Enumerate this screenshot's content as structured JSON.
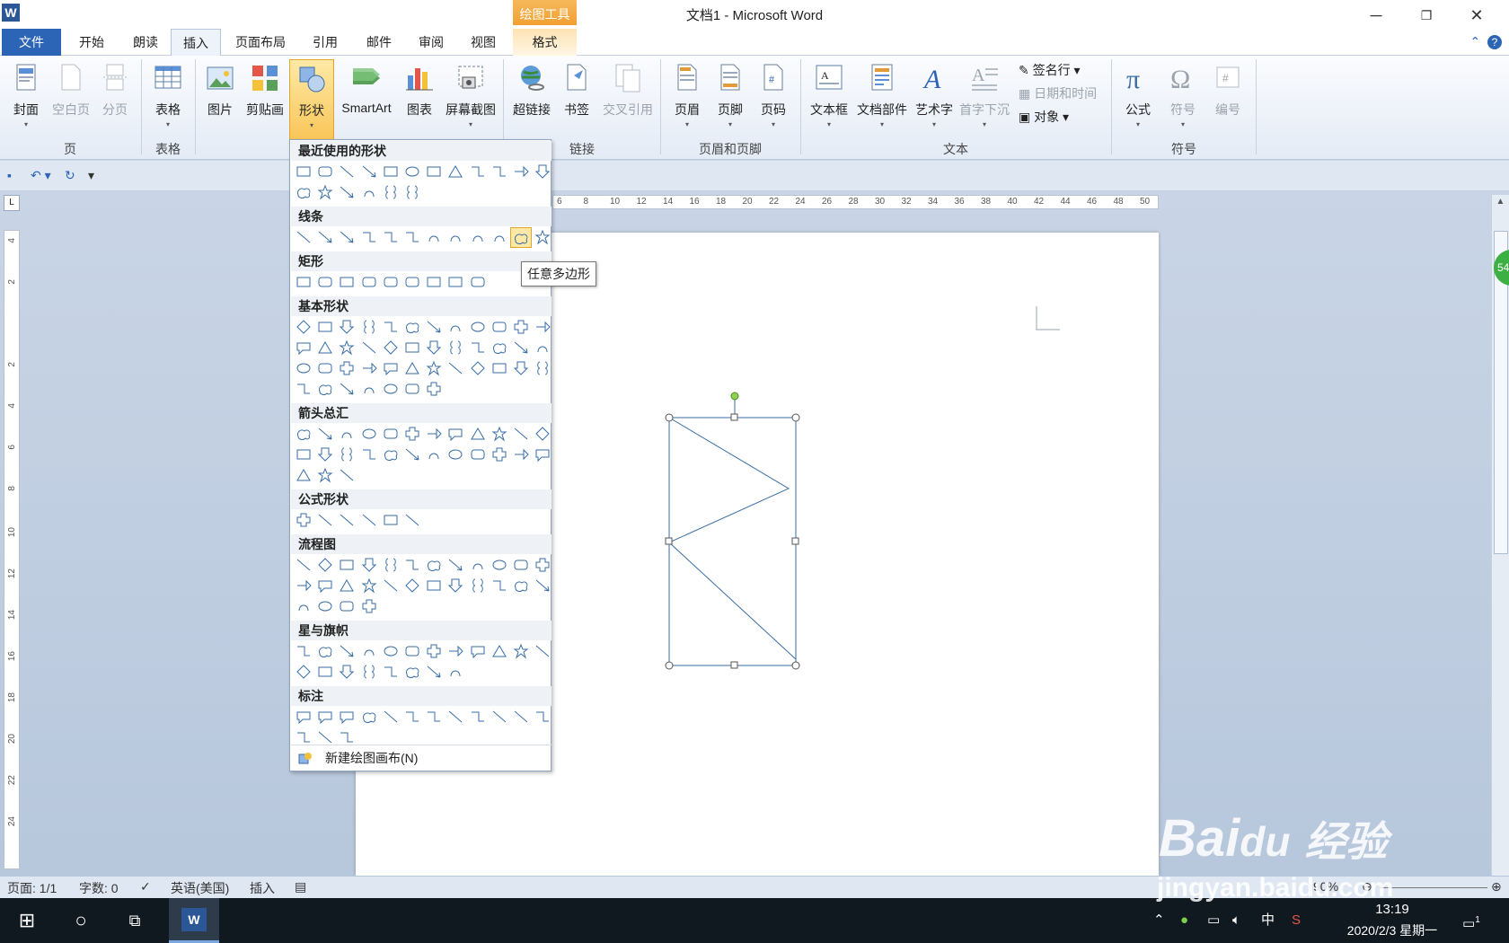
{
  "window": {
    "title": "文档1 - Microsoft Word",
    "app_icon": "W",
    "drawing_tools_label": "绘图工具"
  },
  "tabs": [
    {
      "label": "文件"
    },
    {
      "label": "开始"
    },
    {
      "label": "朗读"
    },
    {
      "label": "插入"
    },
    {
      "label": "页面布局"
    },
    {
      "label": "引用"
    },
    {
      "label": "邮件"
    },
    {
      "label": "审阅"
    },
    {
      "label": "视图"
    },
    {
      "label": "格式"
    }
  ],
  "ribbon": {
    "buttons": [
      {
        "label": "封面",
        "icon": "cover-page-icon"
      },
      {
        "label": "空白页",
        "icon": "blank-page-icon"
      },
      {
        "label": "分页",
        "icon": "page-break-icon"
      },
      {
        "label": "表格",
        "icon": "table-icon"
      },
      {
        "label": "图片",
        "icon": "picture-icon"
      },
      {
        "label": "剪贴画",
        "icon": "clip-art-icon"
      },
      {
        "label": "形状",
        "icon": "shapes-icon"
      },
      {
        "label": "SmartArt",
        "icon": "smartart-icon"
      },
      {
        "label": "图表",
        "icon": "chart-icon"
      },
      {
        "label": "屏幕截图",
        "icon": "screenshot-icon"
      },
      {
        "label": "超链接",
        "icon": "hyperlink-icon"
      },
      {
        "label": "书签",
        "icon": "bookmark-icon"
      },
      {
        "label": "交叉引用",
        "icon": "cross-reference-icon"
      },
      {
        "label": "页眉",
        "icon": "header-icon"
      },
      {
        "label": "页脚",
        "icon": "footer-icon"
      },
      {
        "label": "页码",
        "icon": "page-number-icon"
      },
      {
        "label": "文本框",
        "icon": "text-box-icon"
      },
      {
        "label": "文档部件",
        "icon": "quick-parts-icon"
      },
      {
        "label": "艺术字",
        "icon": "wordart-icon"
      },
      {
        "label": "首字下沉",
        "icon": "drop-cap-icon"
      },
      {
        "label": "公式",
        "icon": "equation-icon"
      },
      {
        "label": "符号",
        "icon": "symbol-icon"
      },
      {
        "label": "编号",
        "icon": "number-icon"
      }
    ],
    "small": [
      {
        "label": "签名行",
        "icon": "signature-line-icon"
      },
      {
        "label": "日期和时间",
        "icon": "date-time-icon"
      },
      {
        "label": "对象",
        "icon": "object-icon"
      }
    ],
    "groups": [
      {
        "label": "页"
      },
      {
        "label": "表格"
      },
      {
        "label": "链接"
      },
      {
        "label": "页眉和页脚"
      },
      {
        "label": "文本"
      },
      {
        "label": "符号"
      }
    ]
  },
  "ruler": {
    "h_labels": [
      "6",
      "8",
      "10",
      "12",
      "14",
      "16",
      "18",
      "20",
      "22",
      "24",
      "26",
      "28",
      "30",
      "32",
      "34",
      "36",
      "38",
      "40",
      "42",
      "44",
      "46",
      "48",
      "50"
    ],
    "v_labels": [
      "4",
      "2",
      "",
      "2",
      "4",
      "6",
      "8",
      "10",
      "12",
      "14",
      "16",
      "18",
      "20",
      "22",
      "24"
    ],
    "corner": "L"
  },
  "gallery": {
    "sections": [
      {
        "title": "最近使用的形状",
        "count": 18
      },
      {
        "title": "线条",
        "count": 12
      },
      {
        "title": "矩形",
        "count": 9
      },
      {
        "title": "基本形状",
        "count": 43
      },
      {
        "title": "箭头总汇",
        "count": 27
      },
      {
        "title": "公式形状",
        "count": 6
      },
      {
        "title": "流程图",
        "count": 28
      },
      {
        "title": "星与旗帜",
        "count": 20
      },
      {
        "title": "标注",
        "count": 15
      }
    ],
    "footer": "新建绘图画布(N)",
    "tooltip": "任意多边形"
  },
  "status": {
    "page": "页面: 1/1",
    "words": "字数: 0",
    "language": "英语(美国)",
    "mode": "插入",
    "zoom": "90%"
  },
  "side_badge": "54",
  "taskbar": {
    "time": "13:19",
    "date": "2020/2/3 星期一",
    "ime": "中",
    "notifications": "1"
  },
  "watermark": {
    "line1": "Bai",
    "line2": "du",
    "line3": "经验",
    "url": "jingyan.baidu.com"
  },
  "colors": {
    "accent": "#2c64b6",
    "drawing_tools": "#f0a030",
    "shape_stroke": "#3a6ea5"
  }
}
